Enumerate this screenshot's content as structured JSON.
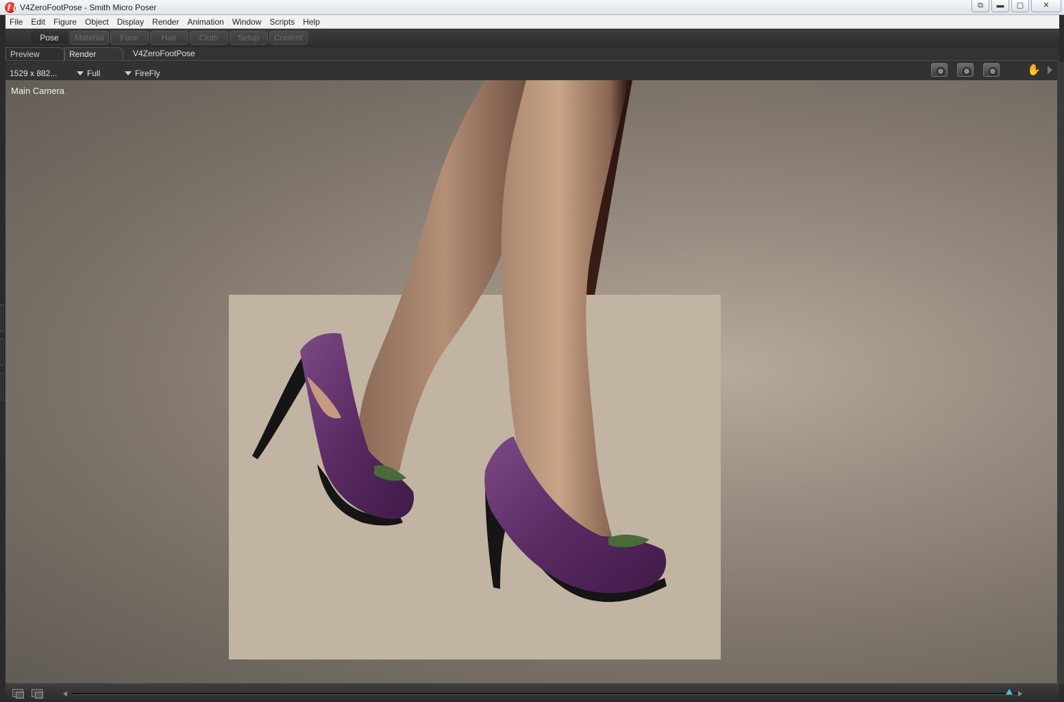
{
  "window": {
    "title": "V4ZeroFootPose - Smith Micro Poser",
    "controls": {
      "restore_icon": "restore-icon",
      "minimize": "▬",
      "maximize": "▢",
      "close": "✕"
    }
  },
  "menu": {
    "items": [
      {
        "label": "File"
      },
      {
        "label": "Edit"
      },
      {
        "label": "Figure"
      },
      {
        "label": "Object"
      },
      {
        "label": "Display"
      },
      {
        "label": "Render"
      },
      {
        "label": "Animation"
      },
      {
        "label": "Window"
      },
      {
        "label": "Scripts"
      },
      {
        "label": "Help"
      }
    ]
  },
  "rooms": {
    "tabs": [
      {
        "label": "Pose",
        "active": true
      },
      {
        "label": "Material"
      },
      {
        "label": "Face"
      },
      {
        "label": "Hair"
      },
      {
        "label": "Cloth"
      },
      {
        "label": "Setup"
      },
      {
        "label": "Content"
      }
    ]
  },
  "document": {
    "tabs": [
      {
        "label": "Preview"
      },
      {
        "label": "Render",
        "active": true
      }
    ],
    "name": "V4ZeroFootPose"
  },
  "render_toolbar": {
    "resolution": "1529 x 882...",
    "quality": "Full",
    "renderer": "FireFly",
    "icons": [
      "render-camera-icon",
      "area-render-icon",
      "render-settings-icon",
      "hand-icon",
      "play-arrow-icon"
    ]
  },
  "viewport": {
    "camera_label": "Main Camera"
  },
  "colors": {
    "shoe": "#5a2a63",
    "shoe_highlight": "#7c4a86",
    "skin": "#c9a487",
    "heel": "#151515"
  },
  "status_bar": {
    "icons": [
      "layout-icon-1",
      "layout-icon-2"
    ],
    "timeline_position": 0.985
  }
}
